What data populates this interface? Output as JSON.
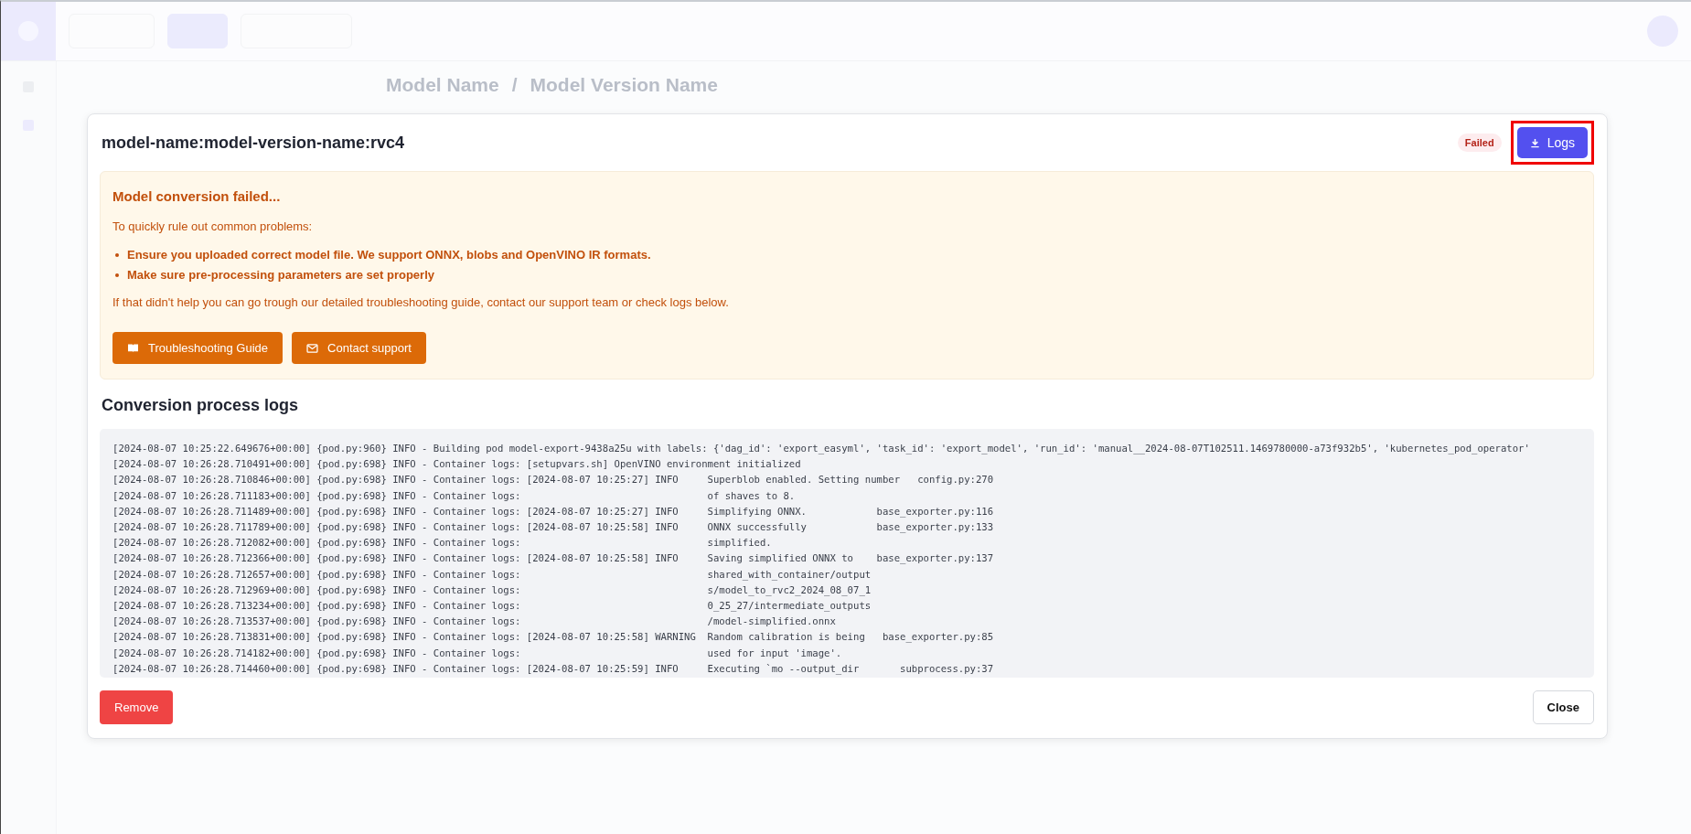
{
  "background": {
    "breadcrumb": [
      "Model Name",
      "/",
      "Model Version Name"
    ]
  },
  "dialog": {
    "title": "model-name:model-version-name:rvc4",
    "status": {
      "label": "Failed",
      "kind": "failed"
    },
    "logs_button": {
      "label": "Logs",
      "highlighted": true
    },
    "alert": {
      "title": "Model conversion failed...",
      "intro": "To quickly rule out common problems:",
      "tips": [
        "Ensure you uploaded correct model file. We support ONNX, blobs and OpenVINO IR formats.",
        "Make sure pre-processing parameters are set properly"
      ],
      "note": "If that didn't help you can go trough our detailed troubleshooting guide, contact our support team or check logs below.",
      "buttons": [
        {
          "label": "Troubleshooting Guide"
        },
        {
          "label": "Contact support"
        }
      ]
    },
    "logs_title": "Conversion process logs",
    "logs": [
      "[2024-08-07 10:25:22.649676+00:00] {pod.py:960} INFO - Building pod model-export-9438a25u with labels: {'dag_id': 'export_easyml', 'task_id': 'export_model', 'run_id': 'manual__2024-08-07T102511.1469780000-a73f932b5', 'kubernetes_pod_operator'",
      "[2024-08-07 10:26:28.710491+00:00] {pod.py:698} INFO - Container logs: [setupvars.sh] OpenVINO environment initialized",
      "[2024-08-07 10:26:28.710846+00:00] {pod.py:698} INFO - Container logs: [2024-08-07 10:25:27] INFO     Superblob enabled. Setting number   config.py:270",
      "[2024-08-07 10:26:28.711183+00:00] {pod.py:698} INFO - Container logs:                                of shaves to 8.",
      "[2024-08-07 10:26:28.711489+00:00] {pod.py:698} INFO - Container logs: [2024-08-07 10:25:27] INFO     Simplifying ONNX.            base_exporter.py:116",
      "[2024-08-07 10:26:28.711789+00:00] {pod.py:698} INFO - Container logs: [2024-08-07 10:25:58] INFO     ONNX successfully            base_exporter.py:133",
      "[2024-08-07 10:26:28.712082+00:00] {pod.py:698} INFO - Container logs:                                simplified.",
      "[2024-08-07 10:26:28.712366+00:00] {pod.py:698} INFO - Container logs: [2024-08-07 10:25:58] INFO     Saving simplified ONNX to    base_exporter.py:137",
      "[2024-08-07 10:26:28.712657+00:00] {pod.py:698} INFO - Container logs:                                shared_with_container/output",
      "[2024-08-07 10:26:28.712969+00:00] {pod.py:698} INFO - Container logs:                                s/model_to_rvc2_2024_08_07_1",
      "[2024-08-07 10:26:28.713234+00:00] {pod.py:698} INFO - Container logs:                                0_25_27/intermediate_outputs",
      "[2024-08-07 10:26:28.713537+00:00] {pod.py:698} INFO - Container logs:                                /model-simplified.onnx",
      "[2024-08-07 10:26:28.713831+00:00] {pod.py:698} INFO - Container logs: [2024-08-07 10:25:58] WARNING  Random calibration is being   base_exporter.py:85",
      "[2024-08-07 10:26:28.714182+00:00] {pod.py:698} INFO - Container logs:                                used for input 'image'.",
      "[2024-08-07 10:26:28.714460+00:00] {pod.py:698} INFO - Container logs: [2024-08-07 10:25:59] INFO     Executing `mo --output_dir       subprocess.py:37"
    ],
    "footer": {
      "remove": "Remove",
      "close": "Close"
    }
  }
}
